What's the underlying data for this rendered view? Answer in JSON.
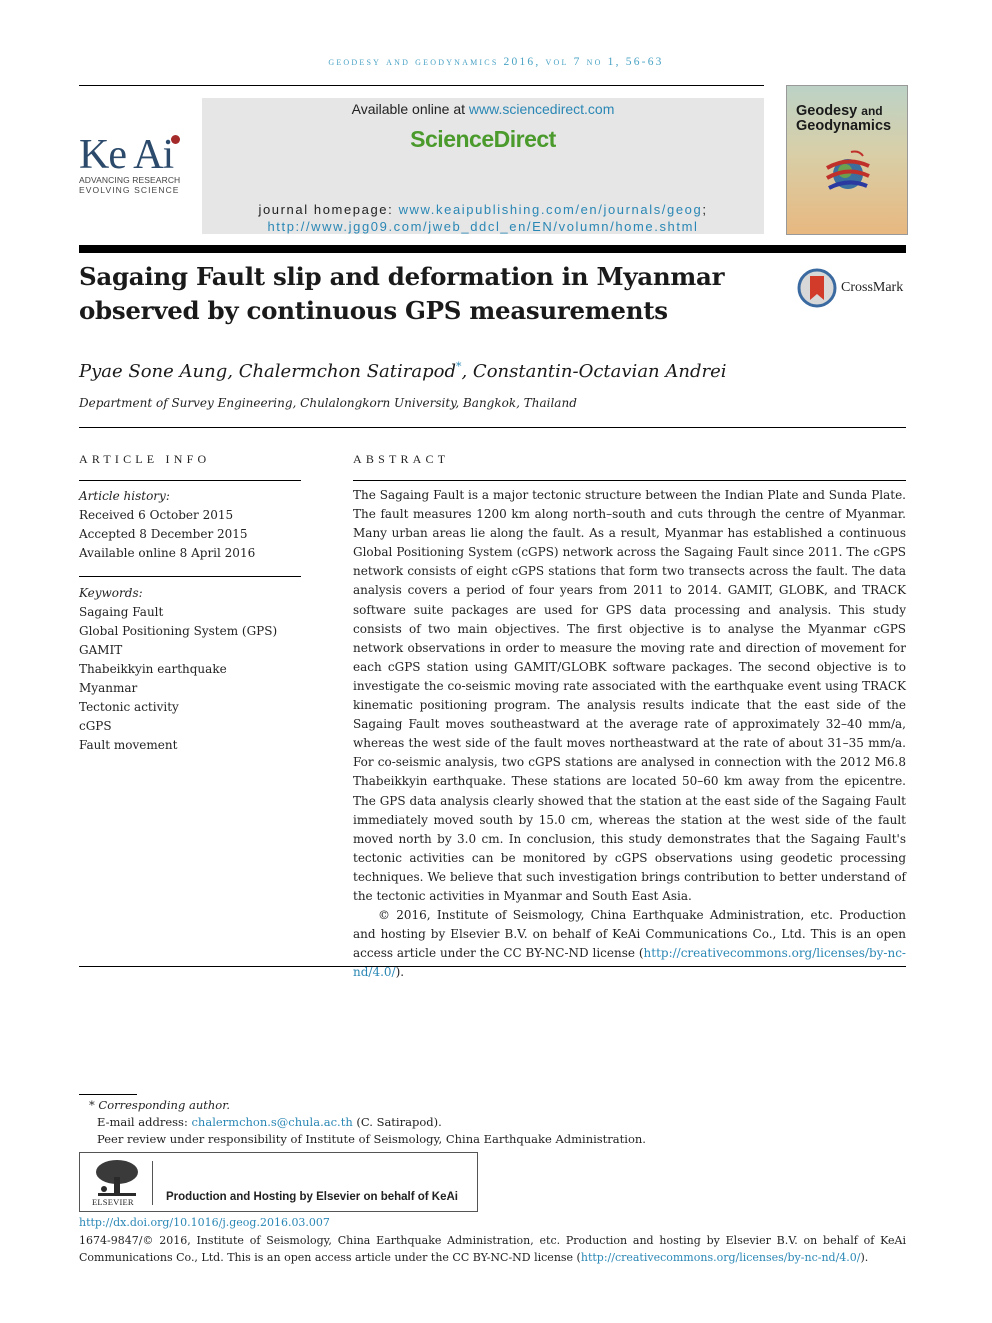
{
  "running_head": "Geodesy and Geodynamics 2016, Vol 7 No 1, 56-63",
  "publisher_logo": {
    "name": "Ke Ai",
    "tagline_1": "ADVANCING RESEARCH",
    "tagline_2": "EVOLVING SCIENCE",
    "dot_color": "#a52a2a"
  },
  "sciencedirect": {
    "available_prefix": "Available online at ",
    "available_link": "www.sciencedirect.com",
    "brand": "ScienceDirect",
    "brand_color": "#4a9a2c",
    "homepage_prefix": "journal homepage: ",
    "homepage_link_1": "www.keaipublishing.com/en/journals/geog",
    "homepage_sep": ";",
    "homepage_link_2": "http://www.jgg09.com/jweb_ddcl_en/EN/volumn/home.shtml"
  },
  "cover": {
    "title_1": "Geodesy",
    "title_and": "and",
    "title_2": "Geodynamics"
  },
  "article": {
    "title": "Sagaing Fault slip and deformation in Myanmar observed by continuous GPS measurements",
    "crossmark_label": "CrossMark",
    "authors": [
      {
        "name": "Pyae Sone Aung",
        "sep": ", "
      },
      {
        "name": "Chalermchon Satirapod",
        "mark": "*",
        "sep": ", "
      },
      {
        "name": "Constantin-Octavian Andrei",
        "sep": ""
      }
    ],
    "affiliation": "Department of Survey Engineering, Chulalongkorn University, Bangkok, Thailand"
  },
  "article_info": {
    "heading": "ARTICLE INFO",
    "history_label": "Article history:",
    "history": [
      "Received 6 October 2015",
      "Accepted 8 December 2015",
      "Available online 8 April 2016"
    ],
    "keywords_label": "Keywords:",
    "keywords": [
      "Sagaing Fault",
      "Global Positioning System (GPS)",
      "GAMIT",
      "Thabeikkyin earthquake",
      "Myanmar",
      "Tectonic activity",
      "cGPS",
      "Fault movement"
    ]
  },
  "abstract": {
    "heading": "ABSTRACT",
    "body": "The Sagaing Fault is a major tectonic structure between the Indian Plate and Sunda Plate. The fault measures 1200 km along north–south and cuts through the centre of Myanmar. Many urban areas lie along the fault. As a result, Myanmar has established a continuous Global Positioning System (cGPS) network across the Sagaing Fault since 2011. The cGPS network consists of eight cGPS stations that form two transects across the fault. The data analysis covers a period of four years from 2011 to 2014. GAMIT, GLOBK, and TRACK software suite packages are used for GPS data processing and analysis. This study consists of two main objectives. The first objective is to analyse the Myanmar cGPS network observations in order to measure the moving rate and direction of movement for each cGPS station using GAMIT/GLOBK software packages. The second objective is to investigate the co-seismic moving rate associated with the earthquake event using TRACK kinematic positioning program. The analysis results indicate that the east side of the Sagaing Fault moves southeastward at the average rate of approximately 32–40 mm/a, whereas the west side of the fault moves northeastward at the rate of about 31–35 mm/a. For co-seismic analysis, two cGPS stations are analysed in connection with the 2012 M6.8 Thabeikkyin earthquake. These stations are located 50–60 km away from the epicentre. The GPS data analysis clearly showed that the station at the east side of the Sagaing Fault immediately moved south by 15.0 cm, whereas the station at the west side of the fault moved north by 3.0 cm. In conclusion, this study demonstrates that the Sagaing Fault's tectonic activities can be monitored by cGPS observations using geodetic processing techniques. We believe that such investigation brings contribution to better understand of the tectonic activities in Myanmar and South East Asia.",
    "copyright": "© 2016, Institute of Seismology, China Earthquake Administration, etc. Production and hosting by Elsevier B.V. on behalf of KeAi Communications Co., Ltd. This is an open access article under the CC BY-NC-ND license (",
    "license_link": "http://creativecommons.org/licenses/by-nc-nd/4.0/",
    "copyright_end": ")."
  },
  "footnotes": {
    "corresponding_mark": "*",
    "corresponding_label": "Corresponding author.",
    "email_label": "E-mail address: ",
    "email": "chalermchon.s@chula.ac.th",
    "email_suffix": " (C. Satirapod).",
    "peer_review": "Peer review under responsibility of Institute of Seismology, China Earthquake Administration."
  },
  "elsevier_box": {
    "logo_word": "ELSEVIER",
    "text": "Production and Hosting by Elsevier on behalf of KeAi"
  },
  "doi": "http://dx.doi.org/10.1016/j.geog.2016.03.007",
  "issn_line": "1674-9847/© 2016, Institute of Seismology, China Earthquake Administration, etc. Production and hosting by Elsevier B.V. on behalf of KeAi Communications Co., Ltd. This is an open access article under the CC BY-NC-ND license (",
  "issn_link": "http://creativecommons.org/licenses/by-nc-nd/4.0/",
  "issn_end": ").",
  "colors": {
    "link": "#2a87b5",
    "running_head": "#4aa3c5",
    "keai_blue": "#2c4a6b"
  }
}
